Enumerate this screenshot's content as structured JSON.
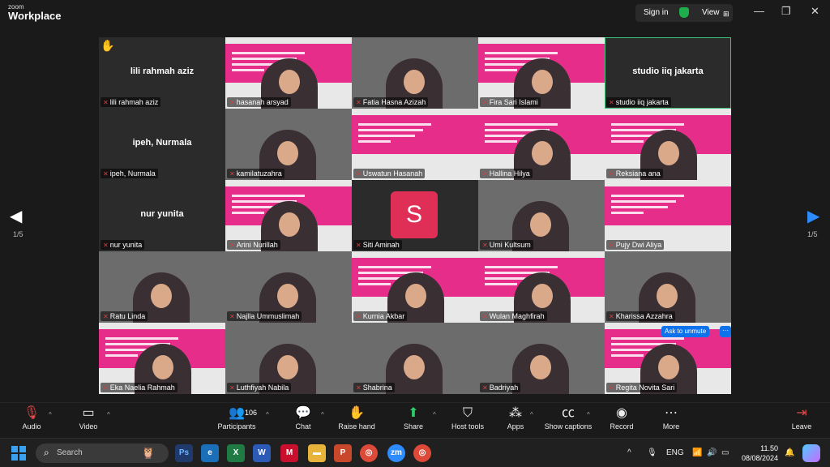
{
  "app": {
    "logo_top": "zoom",
    "logo_bottom": "Workplace"
  },
  "header": {
    "signin_label": "Sign in",
    "view_label": "View",
    "view_icon": "⊞"
  },
  "pages": {
    "indicator": "1/5"
  },
  "tiles": [
    {
      "name": "lili rahmah aziz",
      "kind": "name",
      "display": "lili rahmah aziz",
      "hand": "✋"
    },
    {
      "name": "hasanah arsyad",
      "kind": "slidevideo"
    },
    {
      "name": "Fatia Hasna Azizah",
      "kind": "video"
    },
    {
      "name": "Fira Sari Islami",
      "kind": "slidevideo"
    },
    {
      "name": "studio iiq jakarta",
      "kind": "name",
      "display": "studio iiq jakarta",
      "active": true
    },
    {
      "name": "ipeh, Nurmala",
      "kind": "name",
      "display": "ipeh, Nurmala"
    },
    {
      "name": "kamilatuzahra",
      "kind": "video"
    },
    {
      "name": "Uswatun Hasanah",
      "kind": "slide"
    },
    {
      "name": "Hallina Hilya",
      "kind": "slidevideo"
    },
    {
      "name": "Reksiana ana",
      "kind": "slidevideo"
    },
    {
      "name": "nur yunita",
      "kind": "name",
      "display": "nur yunita"
    },
    {
      "name": "Arini Nurillah",
      "kind": "slidevideo"
    },
    {
      "name": "Siti Aminah",
      "kind": "avatar",
      "initial": "S"
    },
    {
      "name": "Umi Kultsum",
      "kind": "video"
    },
    {
      "name": "Pujy Dwi Aliya",
      "kind": "slide"
    },
    {
      "name": "Ratu Linda",
      "kind": "video"
    },
    {
      "name": "Najlla Ummuslimah",
      "kind": "video"
    },
    {
      "name": "Kurnia Akbar",
      "kind": "slidevideo"
    },
    {
      "name": "Wulan Maghfirah",
      "kind": "slidevideo"
    },
    {
      "name": "Kharissa Azzahra",
      "kind": "video"
    },
    {
      "name": "Eka Naelia Rahmah",
      "kind": "slidevideo"
    },
    {
      "name": "Luthfiyah Nabila",
      "kind": "video"
    },
    {
      "name": "Shabrina",
      "kind": "video"
    },
    {
      "name": "Badriyah",
      "kind": "video"
    },
    {
      "name": "Regita Novita Sari",
      "kind": "slidevideo"
    }
  ],
  "ask_to_unmute": {
    "label": "Ask to unmute",
    "more": "···"
  },
  "toolbar": {
    "audio": "Audio",
    "video": "Video",
    "participants": "Participants",
    "participants_count": "106",
    "chat": "Chat",
    "raise_hand": "Raise hand",
    "share": "Share",
    "host_tools": "Host tools",
    "apps": "Apps",
    "show_captions": "Show captions",
    "record": "Record",
    "more": "More",
    "leave": "Leave"
  },
  "taskbar": {
    "search_placeholder": "Search",
    "lang": "ENG",
    "time": "11.50",
    "date": "08/08/2024"
  },
  "colors": {
    "accent": "#0e72ed",
    "slide_pink": "#e62d8a",
    "avatar_red": "#e02f57",
    "active_green": "#3cc27a"
  }
}
